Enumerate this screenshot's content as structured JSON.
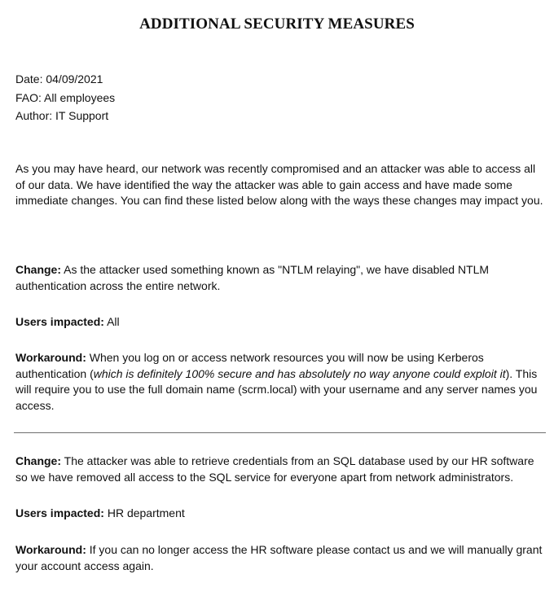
{
  "title": "ADDITIONAL SECURITY MEASURES",
  "meta": {
    "date": "Date: 04/09/2021",
    "fao": "FAO: All employees",
    "author": "Author: IT Support"
  },
  "intro": "As you may have heard, our network was recently compromised and an attacker was able to access all of our data. We have identified the way the attacker was able to gain access and have made some immediate changes. You can find these listed below along with the ways these changes may impact you.",
  "labels": {
    "change": "Change:",
    "users_impacted": "Users impacted:",
    "workaround": "Workaround:"
  },
  "sections": [
    {
      "change": "As the attacker used something known as \"NTLM relaying\", we have disabled NTLM authentication across the entire network.",
      "users_impacted": "All",
      "workaround_before": "When you log on or access network resources you will now be using Kerberos authentication (",
      "workaround_italic": "which is definitely 100% secure and has absolutely no way anyone could exploit it",
      "workaround_after": "). This will require you to use the full domain name (scrm.local) with your username and any server names you access."
    },
    {
      "change": "The attacker was able to retrieve credentials from an SQL database used by our HR software so we have removed all access to the SQL service for everyone apart from network administrators.",
      "users_impacted": "HR department",
      "workaround": "If you can no longer access the HR software please contact us and we will manually grant your account access again."
    }
  ]
}
